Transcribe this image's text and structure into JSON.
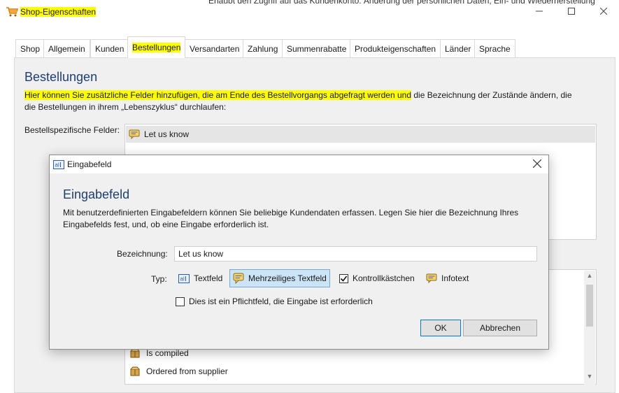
{
  "window": {
    "title": "Shop-Eigenschaften",
    "background_text": "Erlaubt den Zugriff auf das Kundenkonto: Änderung der persönlichen Daten, Ein- und Wiederherstellung"
  },
  "tabs": [
    {
      "label": "Shop"
    },
    {
      "label": "Allgemein"
    },
    {
      "label": "Kunden"
    },
    {
      "label": "Bestellungen",
      "active": true
    },
    {
      "label": "Versandarten"
    },
    {
      "label": "Zahlung"
    },
    {
      "label": "Summenrabatte"
    },
    {
      "label": "Produkteigenschaften"
    },
    {
      "label": "Länder"
    },
    {
      "label": "Sprache"
    }
  ],
  "section": {
    "title": "Bestellungen",
    "desc_highlighted": "Hier können Sie zusätzliche Felder hinzufügen, die am Ende des Bestellvorgangs abgefragt werden und",
    "desc_rest": " die Bezeichnung der Zustände ändern, die die Bestellungen in ihrem „Lebenszyklus“ durchlaufen:",
    "fields_label": "Bestellspezifische Felder:",
    "fields": [
      "Let us know"
    ],
    "states": [
      "Is compiled",
      "Ordered from supplier"
    ]
  },
  "dialog": {
    "title": "Eingabefeld",
    "heading": "Eingabefeld",
    "description": "Mit benutzerdefinierten Eingabefeldern können Sie beliebige Kundendaten erfassen. Legen Sie hier die Bezeichnung Ihres Eingabefelds fest, und, ob eine Eingabe erforderlich ist.",
    "name_label": "Bezeichnung:",
    "name_value": "Let us know",
    "type_label": "Typ:",
    "types": {
      "textfield": "Textfeld",
      "multiline": "Mehrzeiliges Textfeld",
      "checkbox": "Kontrollkästchen",
      "infotext": "Infotext"
    },
    "selected_type": "multiline",
    "required_label": "Dies ist ein Pflichtfeld, die Eingabe ist erforderlich",
    "required_checked": false,
    "ok_label": "OK",
    "cancel_label": "Abbrechen"
  },
  "colors": {
    "highlight": "#ffff00",
    "heading": "#1e3f6e",
    "selected_option": "#cce4f7",
    "panel": "#f0f0f0"
  }
}
